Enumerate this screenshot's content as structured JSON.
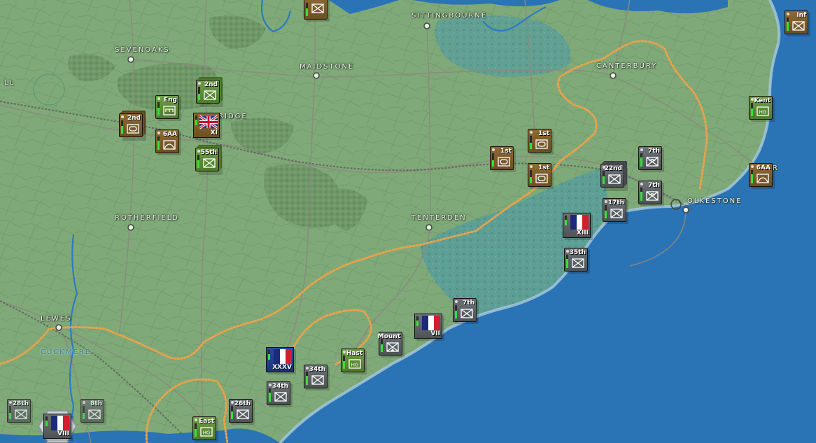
{
  "cities": [
    {
      "id": "sevenoaks",
      "name": "SEVENOAKS"
    },
    {
      "id": "maidstone",
      "name": "MAIDSTONE"
    },
    {
      "id": "sittingbourne",
      "name": "SITTINGBOURNE"
    },
    {
      "id": "canterbury",
      "name": "CANTERBURY"
    },
    {
      "id": "tonbridge",
      "name": "RIDGE"
    },
    {
      "id": "rotherfield",
      "name": "ROTHERFIELD"
    },
    {
      "id": "tenterden",
      "name": "TENTERDEN"
    },
    {
      "id": "folkestone",
      "name": "OLKESTONE"
    },
    {
      "id": "lewes",
      "name": "LEWES"
    },
    {
      "id": "cuckmere",
      "name": "CUCKMERE"
    },
    {
      "id": "left-edge",
      "name": "LL"
    },
    {
      "id": "dover-frag",
      "name": "R"
    }
  ],
  "units": [
    {
      "label": "Inf",
      "faction": "brown",
      "strength": 0.7
    },
    {
      "label": "Eng",
      "faction": "green",
      "strength": 0.6
    },
    {
      "label": "2nd",
      "faction": "green",
      "strength": 0.5
    },
    {
      "label": "2nd",
      "faction": "brown",
      "strength": 0.6
    },
    {
      "label": "6AA",
      "faction": "brown",
      "strength": 0.7
    },
    {
      "label": "55th",
      "faction": "green",
      "strength": 0.6
    },
    {
      "label": "Kent",
      "faction": "green",
      "strength": 0.6
    },
    {
      "label": "1st",
      "faction": "brown",
      "strength": 0.5
    },
    {
      "label": "1st",
      "faction": "brown",
      "strength": 0.5
    },
    {
      "label": "1st",
      "faction": "brown",
      "strength": 0.5
    },
    {
      "label": "7th",
      "faction": "grey",
      "strength": 0.7
    },
    {
      "label": "22nd",
      "faction": "grey",
      "strength": 0.6
    },
    {
      "label": "7th",
      "faction": "grey",
      "strength": 0.7
    },
    {
      "label": "17th",
      "faction": "grey",
      "strength": 0.6
    },
    {
      "label": "6AA",
      "faction": "brown",
      "strength": 0.7
    },
    {
      "label": "35th",
      "faction": "grey",
      "strength": 0.7
    },
    {
      "label": "7th",
      "faction": "grey",
      "strength": 0.6
    },
    {
      "label": "Mount",
      "faction": "grey",
      "strength": 0.6
    },
    {
      "label": "Hast",
      "faction": "green",
      "strength": 0.6
    },
    {
      "label": "34th",
      "faction": "grey",
      "strength": 0.7
    },
    {
      "label": "34th",
      "faction": "grey",
      "strength": 0.7
    },
    {
      "label": "26th",
      "faction": "grey",
      "strength": 0.6
    },
    {
      "label": "East",
      "faction": "green",
      "strength": 0.6
    },
    {
      "label": "28th",
      "faction": "grey",
      "strength": 0.5
    },
    {
      "label": "8th",
      "faction": "grey",
      "strength": 0.5
    }
  ],
  "headquarters": [
    {
      "name": "XI",
      "flag": "uk"
    },
    {
      "name": "XIII",
      "flag": "fr"
    },
    {
      "name": "VII",
      "flag": "fr"
    },
    {
      "name": "XXXV",
      "flag": "fr"
    },
    {
      "name": "VIII",
      "flag": "fr"
    }
  ],
  "colors": {
    "land": "#7fa877",
    "sea": "#2a73b5",
    "marsh": "#5c9f93",
    "forest": "#6a9163",
    "front_line": "#e9a24a",
    "road": "#8b8a7e",
    "river": "#2c7bc0",
    "strength_bar": "#35e03a"
  }
}
